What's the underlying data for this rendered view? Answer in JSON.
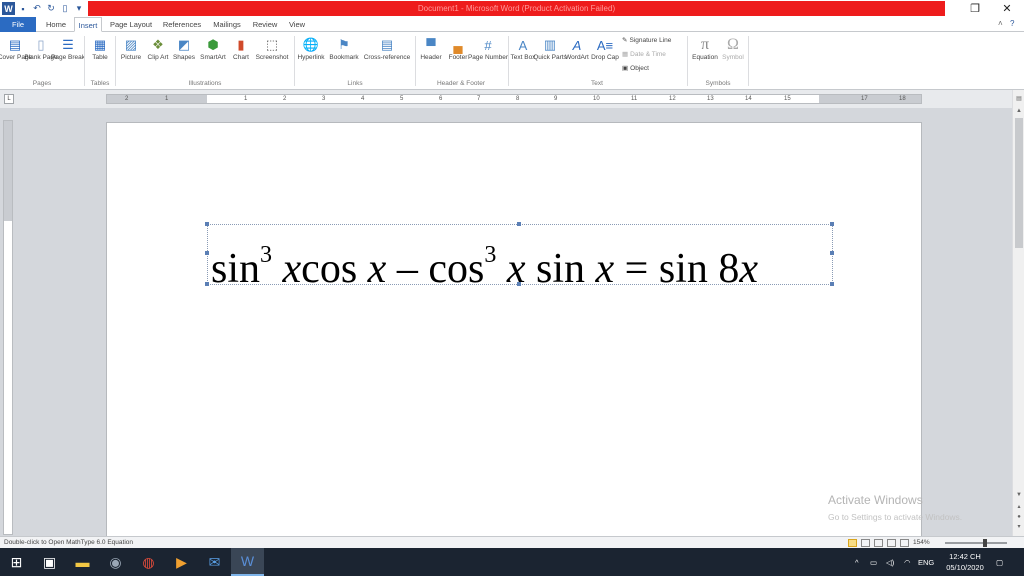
{
  "titlebar": {
    "title": "Document1 - Microsoft Word (Product Activation Failed)",
    "app_icon": "W",
    "restore_icon": "❐",
    "close_icon": "✕",
    "minimize_icon": "—",
    "title_bg": "#ee1c1c"
  },
  "tabs": [
    "File",
    "Home",
    "Insert",
    "Page Layout",
    "References",
    "Mailings",
    "Review",
    "View"
  ],
  "ribbon": {
    "pages": {
      "cover": "Cover Page",
      "blank": "Blank Page",
      "break": "Page Break",
      "group": "Pages"
    },
    "tables": {
      "table": "Table",
      "group": "Tables"
    },
    "illustrations": {
      "picture": "Picture",
      "clipart": "Clip Art",
      "shapes": "Shapes",
      "smartart": "SmartArt",
      "chart": "Chart",
      "screenshot": "Screenshot",
      "group": "Illustrations"
    },
    "links": {
      "hyperlink": "Hyperlink",
      "bookmark": "Bookmark",
      "crossref": "Cross-reference",
      "group": "Links"
    },
    "header_footer": {
      "header": "Header",
      "footer": "Footer",
      "pagenum": "Page Number",
      "group": "Header & Footer"
    },
    "text": {
      "textbox": "Text Box",
      "quickparts": "Quick Parts",
      "wordart": "WordArt",
      "dropcap": "Drop Cap",
      "sigline": "Signature Line",
      "datetime": "Date & Time",
      "object": "Object",
      "group": "Text"
    },
    "symbols": {
      "equation": "Equation",
      "symbol": "Symbol",
      "group": "Symbols"
    }
  },
  "ruler": {
    "numbers": [
      "2",
      "1",
      "1",
      "2",
      "3",
      "4",
      "5",
      "6",
      "7",
      "8",
      "9",
      "10",
      "11",
      "12",
      "13",
      "14",
      "15",
      "17",
      "18"
    ]
  },
  "equation": {
    "t1": "sin",
    "e1": "3",
    "t2": "x",
    "t3": "cos",
    "t4": "x",
    "t5": "–",
    "t6": "cos",
    "e2": "3",
    "t7": "x",
    "t8": "sin",
    "t9": "x",
    "t10": "=",
    "t11": "sin",
    "t12": "8",
    "t13": "x"
  },
  "watermark": {
    "line1": "Activate Windows",
    "line2": "Go to Settings to activate Windows."
  },
  "status": {
    "text": "Double-click to Open MathType 6.0 Equation",
    "zoom": "154%"
  },
  "taskbar": {
    "language": "ENG",
    "time": "12:42 CH",
    "date": "05/10/2020"
  }
}
